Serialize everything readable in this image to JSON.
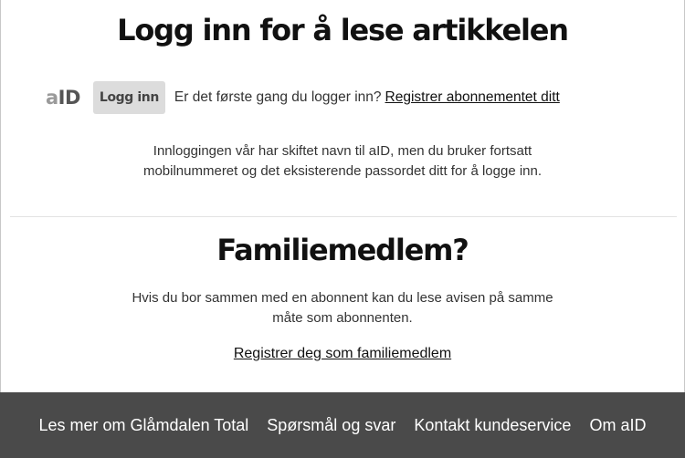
{
  "login": {
    "title": "Logg inn for å lese artikkelen",
    "logo_a": "a",
    "logo_id": "ID",
    "button_label": "Logg inn",
    "first_time_text": "Er det første gang du logger inn?",
    "register_link": "Registrer abonnementet ditt",
    "info_line1": "Innloggingen vår har skiftet navn til aID, men du bruker fortsatt",
    "info_line2": "mobilnummeret og det eksisterende passordet ditt for å logge inn."
  },
  "family": {
    "title": "Familiemedlem?",
    "text_line1": "Hvis du bor sammen med en abonnent kan du lese avisen på samme",
    "text_line2": "måte som abonnenten.",
    "register_link": "Registrer deg som familiemedlem"
  },
  "footer": {
    "links": [
      "Les mer om Glåmdalen Total",
      "Spørsmål og svar",
      "Kontakt kundeservice",
      "Om aID"
    ]
  }
}
